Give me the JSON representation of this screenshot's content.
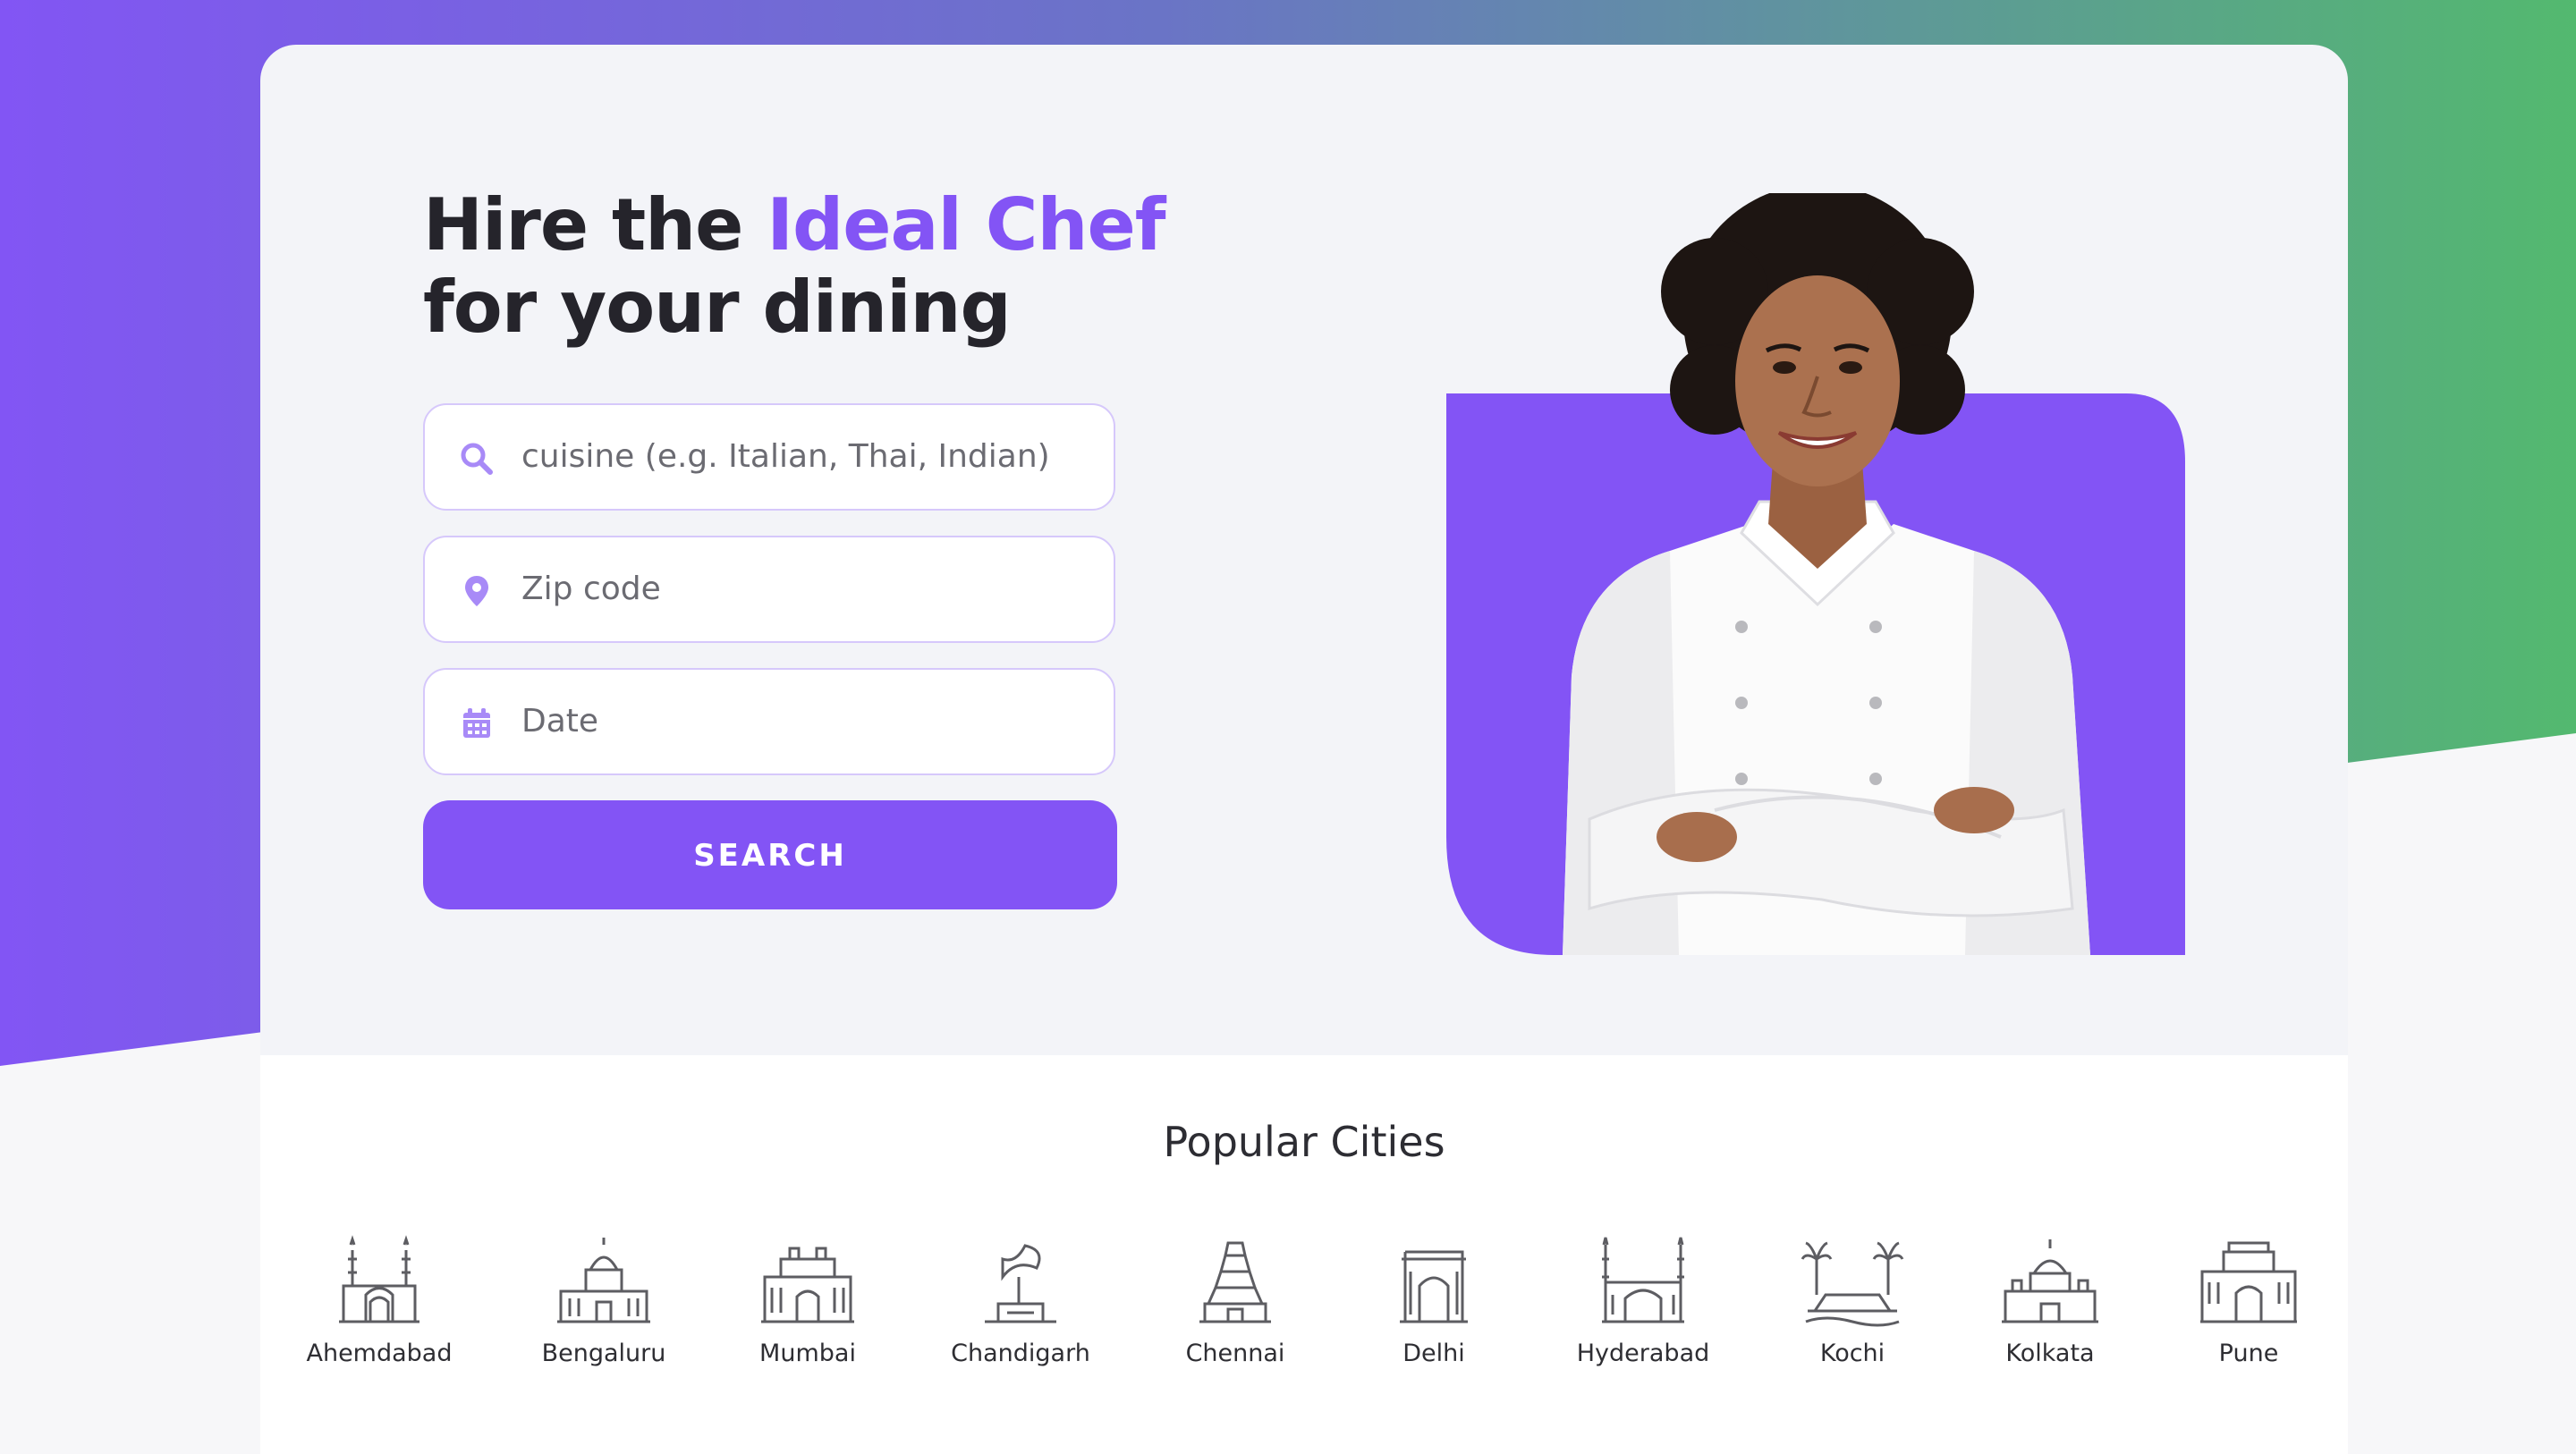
{
  "colors": {
    "accent": "#8354f5",
    "gradient_green": "#53b96f",
    "heading": "#25242b"
  },
  "hero": {
    "headline_part1": "Hire the ",
    "headline_accent": "Ideal Chef",
    "headline_part2": "for your dining",
    "image": "smiling chef in white coat with arms crossed"
  },
  "search": {
    "cuisine_placeholder": "cuisine (e.g. Italian, Thai, Indian)",
    "zip_placeholder": "Zip code",
    "date_placeholder": "Date",
    "button_label": "SEARCH",
    "icons": [
      "search-icon",
      "location-pin-icon",
      "calendar-icon"
    ]
  },
  "popular_cities": {
    "title": "Popular Cities",
    "cities": [
      {
        "name": "Ahemdabad",
        "icon": "ahemdabad-landmark-icon"
      },
      {
        "name": "Bengaluru",
        "icon": "bengaluru-landmark-icon"
      },
      {
        "name": "Mumbai",
        "icon": "mumbai-landmark-icon"
      },
      {
        "name": "Chandigarh",
        "icon": "chandigarh-landmark-icon"
      },
      {
        "name": "Chennai",
        "icon": "chennai-landmark-icon"
      },
      {
        "name": "Delhi",
        "icon": "delhi-landmark-icon"
      },
      {
        "name": "Hyderabad",
        "icon": "hyderabad-landmark-icon"
      },
      {
        "name": "Kochi",
        "icon": "kochi-landmark-icon"
      },
      {
        "name": "Kolkata",
        "icon": "kolkata-landmark-icon"
      },
      {
        "name": "Pune",
        "icon": "pune-landmark-icon"
      }
    ]
  }
}
